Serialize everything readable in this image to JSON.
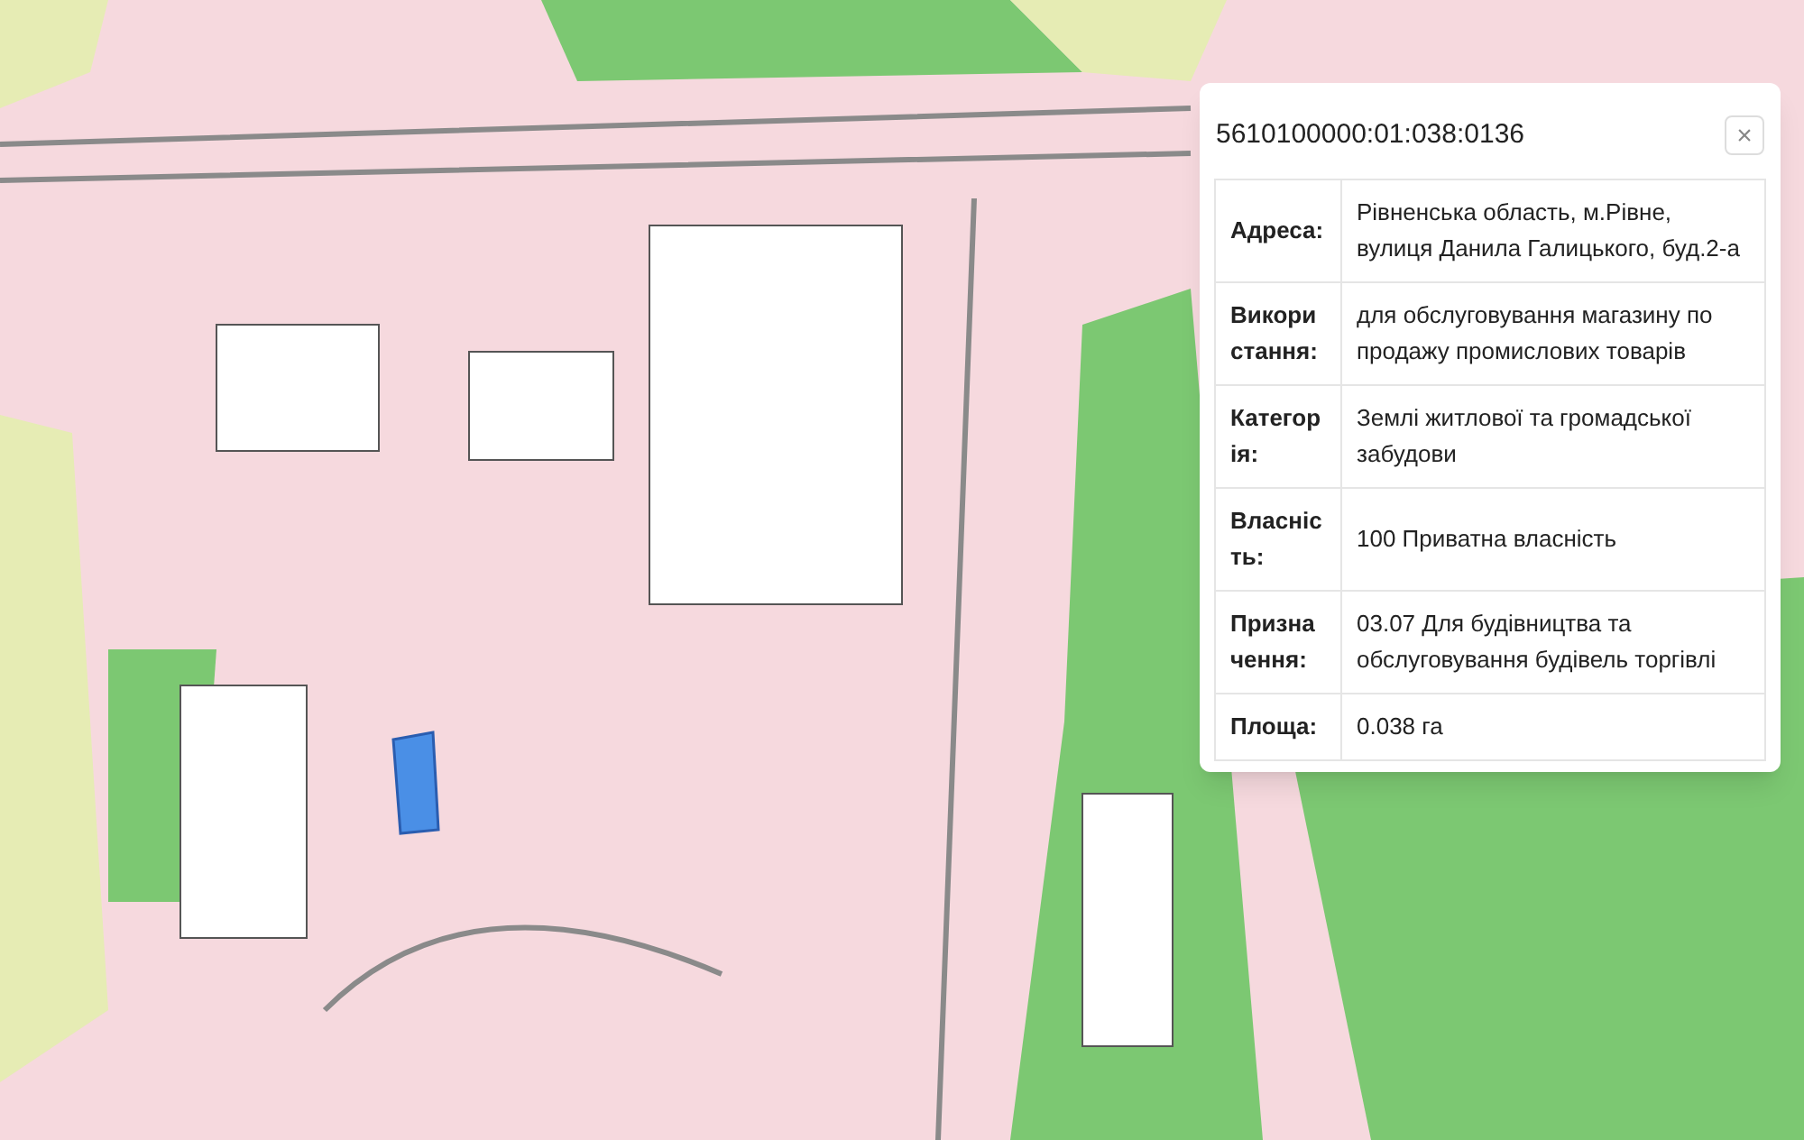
{
  "popup": {
    "title": "5610100000:01:038:0136",
    "close": "×",
    "rows": [
      {
        "label": "Адреса:",
        "value": "Рівненська область, м.Рівне, вулиця Данила Галицького, буд.2-а"
      },
      {
        "label": "Використання:",
        "value": "для обслуговування магазину по продажу промислових товарів"
      },
      {
        "label": "Категорія:",
        "value": "Землі житлової та громадської забудови"
      },
      {
        "label": "Власність:",
        "value": "100 Приватна власність"
      },
      {
        "label": "Призначення:",
        "value": "03.07 Для будівництва та обслуговування будівель торгівлі"
      },
      {
        "label": "Площа:",
        "value": "0.038 га"
      }
    ]
  }
}
